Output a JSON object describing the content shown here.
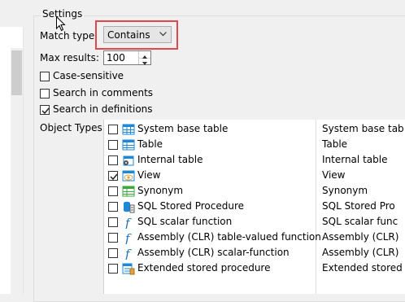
{
  "settings": {
    "group_title": "Settings",
    "match_type_label": "Match type:",
    "match_type_value": "Contains",
    "max_results_label": "Max results:",
    "max_results_value": "100",
    "case_sensitive": {
      "label": "Case-sensitive",
      "checked": false
    },
    "search_comments": {
      "label": "Search in comments",
      "checked": false
    },
    "search_definitions": {
      "label": "Search in definitions",
      "checked": true
    },
    "object_types_label": "Object Types:"
  },
  "object_types": [
    {
      "name": "System base table",
      "col2": "System base tab",
      "checked": false,
      "icon": "system-table-icon"
    },
    {
      "name": "Table",
      "col2": "Table",
      "checked": false,
      "icon": "table-icon"
    },
    {
      "name": "Internal table",
      "col2": "Internal table",
      "checked": false,
      "icon": "internal-table-icon"
    },
    {
      "name": "View",
      "col2": "View",
      "checked": true,
      "icon": "view-icon"
    },
    {
      "name": "Synonym",
      "col2": "Synonym",
      "checked": false,
      "icon": "synonym-icon"
    },
    {
      "name": "SQL Stored Procedure",
      "col2": "SQL Stored Pro",
      "checked": false,
      "icon": "stored-procedure-icon"
    },
    {
      "name": "SQL scalar function",
      "col2": "SQL scalar func",
      "checked": false,
      "icon": "function-icon"
    },
    {
      "name": "Assembly (CLR) table-valued function",
      "col2": "Assembly (CLR)",
      "checked": false,
      "icon": "function-icon"
    },
    {
      "name": "Assembly (CLR) scalar-function",
      "col2": "Assembly (CLR)",
      "checked": false,
      "icon": "function-icon"
    },
    {
      "name": "Extended stored procedure",
      "col2": "Extended stored",
      "checked": false,
      "icon": "extended-procedure-icon"
    }
  ],
  "colors": {
    "highlight": "#e3474d",
    "window_bg": "#f0f0f0",
    "icon_blue": "#1e88d8",
    "icon_green": "#3aa83a",
    "icon_orange": "#e3a23b"
  }
}
